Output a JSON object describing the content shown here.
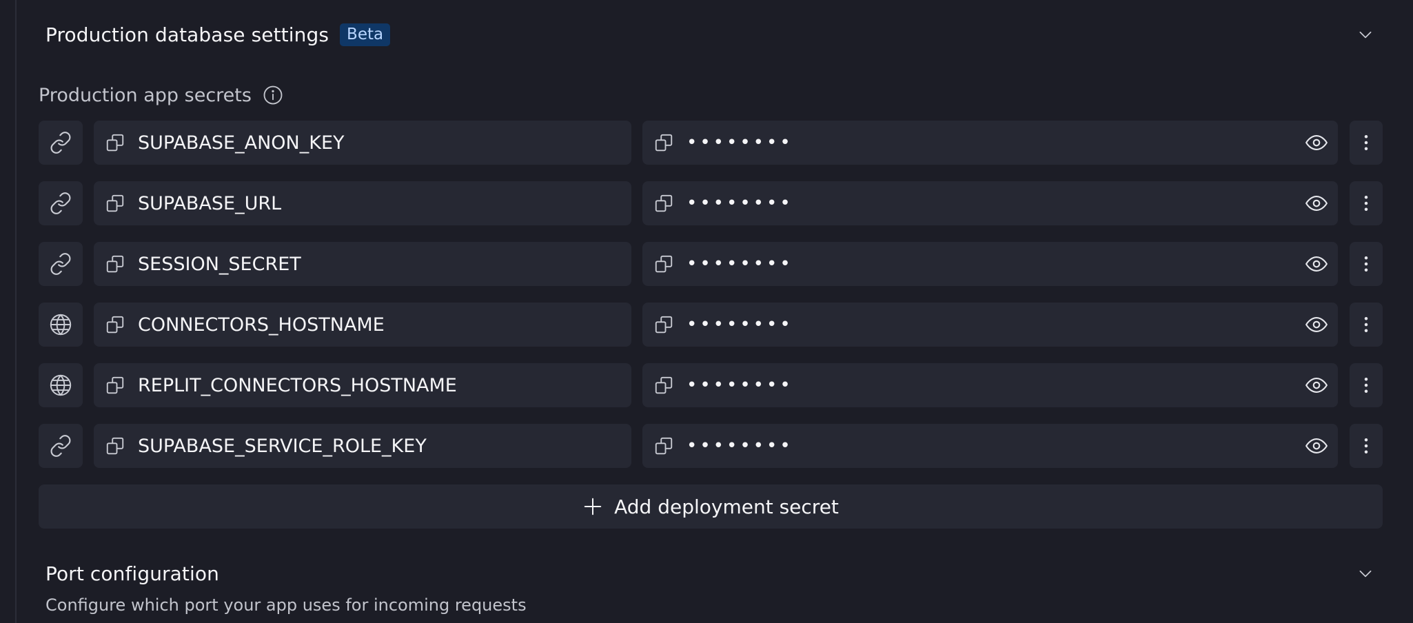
{
  "db_settings": {
    "title": "Production database settings",
    "badge": "Beta"
  },
  "secrets": {
    "label": "Production app secrets",
    "add_label": "Add deployment secret",
    "rows": [
      {
        "type_icon": "link-icon",
        "key": "SUPABASE_ANON_KEY",
        "masked": "••••••••"
      },
      {
        "type_icon": "link-icon",
        "key": "SUPABASE_URL",
        "masked": "••••••••"
      },
      {
        "type_icon": "link-icon",
        "key": "SESSION_SECRET",
        "masked": "••••••••"
      },
      {
        "type_icon": "globe-icon",
        "key": "CONNECTORS_HOSTNAME",
        "masked": "••••••••"
      },
      {
        "type_icon": "globe-icon",
        "key": "REPLIT_CONNECTORS_HOSTNAME",
        "masked": "••••••••"
      },
      {
        "type_icon": "link-icon",
        "key": "SUPABASE_SERVICE_ROLE_KEY",
        "masked": "••••••••"
      }
    ]
  },
  "port_config": {
    "title": "Port configuration",
    "description": "Configure which port your app uses for incoming requests"
  },
  "colors": {
    "background": "#1c1d26",
    "surface": "#262833",
    "text": "#f5f5f7",
    "muted_text": "#c2c4cc",
    "badge_bg": "#0f3766",
    "badge_text": "#b9d6ff",
    "icon": "#c9cbd3"
  }
}
